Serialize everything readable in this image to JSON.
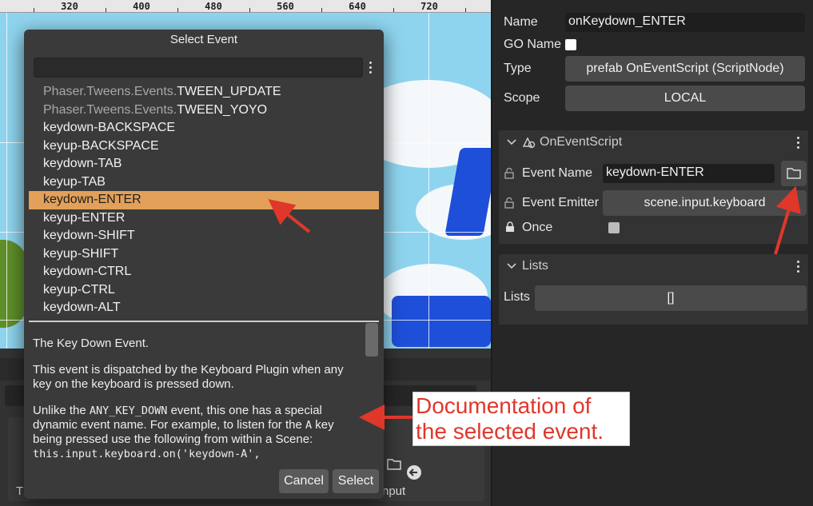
{
  "scene": {
    "ruler_ticks": [
      "320",
      "400",
      "480",
      "560",
      "640",
      "720"
    ]
  },
  "lower_panel": {
    "partial_label_t": "T",
    "partial_label_input": "nput"
  },
  "inspector": {
    "name_label": "Name",
    "name_value": "onKeydown_ENTER",
    "go_name_label": "GO Name",
    "type_label": "Type",
    "type_value": "prefab OnEventScript (ScriptNode)",
    "scope_label": "Scope",
    "scope_value": "LOCAL",
    "on_event_script": {
      "title": "OnEventScript",
      "event_name_label": "Event Name",
      "event_name_value": "keydown-ENTER",
      "event_emitter_label": "Event Emitter",
      "event_emitter_value": "scene.input.keyboard",
      "once_label": "Once"
    },
    "lists_section": {
      "title": "Lists",
      "lists_label": "Lists",
      "lists_value": "[]"
    }
  },
  "modal": {
    "title": "Select Event",
    "filter_value": "",
    "events": [
      {
        "ns": "Phaser.Tweens.Events.",
        "name": "TWEEN_UPDATE"
      },
      {
        "ns": "Phaser.Tweens.Events.",
        "name": "TWEEN_YOYO"
      },
      {
        "ns": "",
        "name": "keydown-BACKSPACE"
      },
      {
        "ns": "",
        "name": "keyup-BACKSPACE"
      },
      {
        "ns": "",
        "name": "keydown-TAB"
      },
      {
        "ns": "",
        "name": "keyup-TAB"
      },
      {
        "ns": "",
        "name": "keydown-ENTER",
        "selected": true
      },
      {
        "ns": "",
        "name": "keyup-ENTER"
      },
      {
        "ns": "",
        "name": "keydown-SHIFT"
      },
      {
        "ns": "",
        "name": "keyup-SHIFT"
      },
      {
        "ns": "",
        "name": "keydown-CTRL"
      },
      {
        "ns": "",
        "name": "keyup-CTRL"
      },
      {
        "ns": "",
        "name": "keydown-ALT"
      }
    ],
    "doc": {
      "p1": "The Key Down Event.",
      "p2": "This event is dispatched by the Keyboard Plugin when any key on the keyboard is pressed down.",
      "p3_a": "Unlike the ",
      "p3_code1": "ANY_KEY_DOWN",
      "p3_b": " event, this one has a special dynamic event name. For example, to listen for the ",
      "p3_code2": "A",
      "p3_c": " key being pressed use the following from within a Scene:",
      "p3_code3": "this.input.keyboard.on('keydown-A',"
    },
    "cancel_label": "Cancel",
    "select_label": "Select"
  },
  "annotation": {
    "callout_text": "Documentation of the selected event.",
    "color": "#e0372b"
  },
  "colors": {
    "selected_row": "#e2a05a",
    "panel_bg": "#262626",
    "modal_bg": "#3a3a3a"
  }
}
